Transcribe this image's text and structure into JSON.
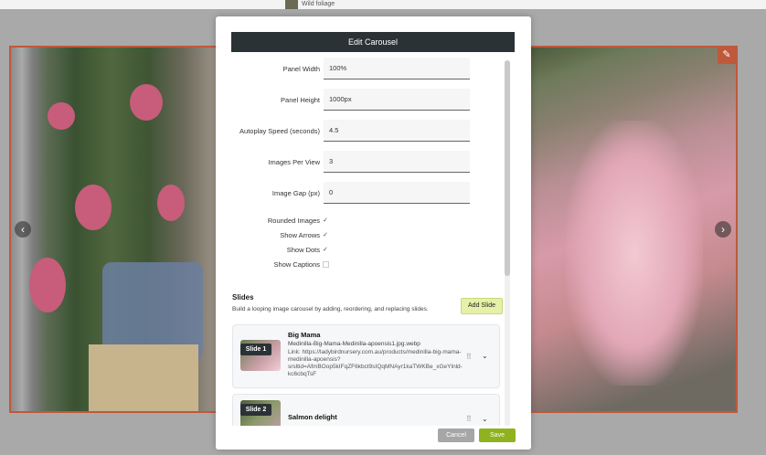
{
  "background": {
    "top_strip_text": "Wild foliage",
    "left_arrow": "‹",
    "right_arrow": "›",
    "edit_badge": "✎"
  },
  "modal": {
    "title": "Edit Carousel",
    "fields": {
      "panel_width": {
        "label": "Panel Width",
        "value": "100%"
      },
      "panel_height": {
        "label": "Panel Height",
        "value": "1000px"
      },
      "autoplay_speed": {
        "label": "Autoplay Speed (seconds)",
        "value": "4.5"
      },
      "images_per_view": {
        "label": "Images Per View",
        "value": "3"
      },
      "image_gap": {
        "label": "Image Gap (px)",
        "value": "0"
      }
    },
    "checkboxes": {
      "rounded_images": {
        "label": "Rounded Images",
        "checked": true,
        "mark": "✓"
      },
      "show_arrows": {
        "label": "Show Arrows",
        "checked": true,
        "mark": "✓"
      },
      "show_dots": {
        "label": "Show Dots",
        "checked": true,
        "mark": "✓"
      },
      "show_captions": {
        "label": "Show Captions",
        "checked": false,
        "mark": ""
      }
    },
    "slides": {
      "title": "Slides",
      "help": "Build a looping image carousel by adding, reordering, and replacing slides.",
      "add_label": "Add Slide",
      "items": [
        {
          "badge": "Slide 1",
          "title": "Big Mama",
          "file": "Medinilla-Big-Mama-Medinilla-apoensis1.jpg.webp",
          "link": "Link: https://ladybirdnursery.com.au/products/medinilla-big-mama-medinilla-apoensis?srsltid=AfmBOop5kIFqZF6kbct9sIQqMNAyr1kaTWKBe_xGeYlnld-kc6cbqTsF"
        },
        {
          "badge": "Slide 2",
          "title": "Salmon delight"
        }
      ],
      "drag_glyph": "⠿",
      "expand_glyph": "⌄"
    },
    "footer": {
      "cancel_label": "Cancel",
      "save_label": "Save"
    }
  },
  "colors": {
    "header_bg": "#2a3235",
    "save_bg": "#8fb21e",
    "cancel_bg": "#a6a6a6",
    "add_slide_bg": "#e6f0a8",
    "carousel_border": "#c0583b"
  }
}
